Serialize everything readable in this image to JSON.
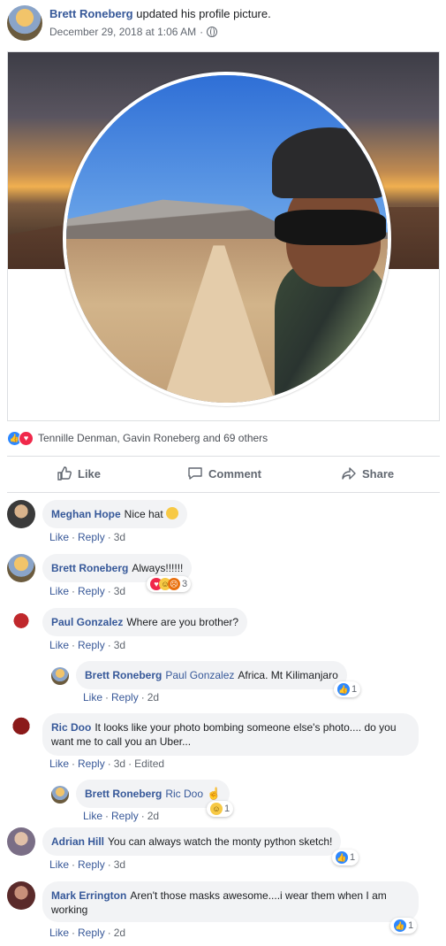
{
  "post": {
    "author": "Brett Roneberg",
    "action": " updated his profile picture.",
    "timestamp": "December 29, 2018 at 1:06 AM",
    "timestamp_sep": "·"
  },
  "reactions": {
    "summary": "Tennille Denman, Gavin Roneberg and 69 others",
    "icons": [
      "like-icon",
      "love-icon"
    ]
  },
  "actions": {
    "like": "Like",
    "comment": "Comment",
    "share": "Share"
  },
  "comments": [
    {
      "author": "Meghan Hope",
      "text": "Nice hat",
      "meta": {
        "like": "Like",
        "reply": "Reply",
        "time": "3d"
      }
    },
    {
      "author": "Brett Roneberg",
      "text": "Always!!!!!!",
      "meta": {
        "like": "Like",
        "reply": "Reply",
        "time": "3d"
      },
      "reaction_count": "3"
    },
    {
      "author": "Paul Gonzalez",
      "text": "Where are you brother?",
      "meta": {
        "like": "Like",
        "reply": "Reply",
        "time": "3d"
      }
    },
    {
      "author": "Brett Roneberg",
      "mention": "Paul Gonzalez",
      "text": "Africa. Mt Kilimanjaro",
      "meta": {
        "like": "Like",
        "reply": "Reply",
        "time": "2d"
      },
      "reaction_count": "1"
    },
    {
      "author": "Ric Doo",
      "text": "It looks like your photo bombing someone else's photo.... do you want me to call you an Uber...",
      "meta": {
        "like": "Like",
        "reply": "Reply",
        "time": "3d",
        "edited": "Edited"
      }
    },
    {
      "author": "Brett Roneberg",
      "mention": "Ric Doo",
      "text": "",
      "meta": {
        "like": "Like",
        "reply": "Reply",
        "time": "2d"
      },
      "reaction_count": "1"
    },
    {
      "author": "Adrian Hill",
      "text": "You can always watch the monty python sketch!",
      "meta": {
        "like": "Like",
        "reply": "Reply",
        "time": "3d"
      },
      "reaction_count": "1"
    },
    {
      "author": "Mark Errington",
      "text": "Aren't those masks awesome....i wear them when I am working",
      "meta": {
        "like": "Like",
        "reply": "Reply",
        "time": "2d"
      },
      "reaction_count": "1"
    }
  ],
  "colors": {
    "link": "#365899",
    "like_blue": "#2d88ff",
    "love_red": "#f0284a",
    "bubble_bg": "#f2f3f5"
  }
}
